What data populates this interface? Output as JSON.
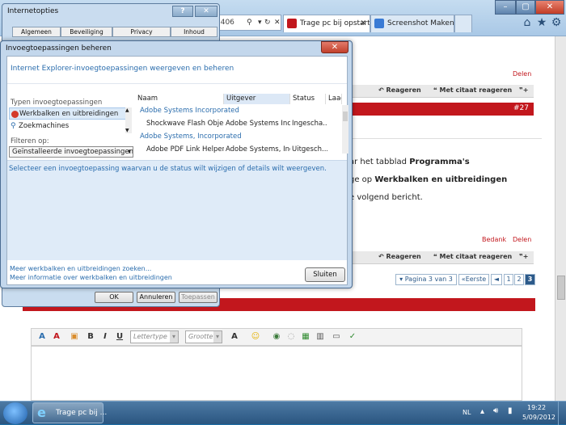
{
  "browser": {
    "address_fragment": "8406",
    "tabs": [
      {
        "label": "Trage pc bij opstart ...",
        "active": true
      },
      {
        "label": "Screenshot Maken - Byt...",
        "active": false
      }
    ],
    "window_controls": {
      "minimize": "–",
      "maximize": "▢",
      "close": "✕"
    }
  },
  "forum": {
    "delen_1": "Delen",
    "reageren": "Reageren",
    "met_citaat": "Met citaat reageren",
    "post_number": "#27",
    "text_line_1_prefix": "ar het tabblad ",
    "text_line_1_bold": "Programma's",
    "text_line_2_prefix": "ge op ",
    "text_line_2_bold": "Werkbalken en uitbreidingen",
    "text_line_3": "e volgend bericht.",
    "bedank": "Bedank",
    "delen_2": "Delen",
    "reageren_2": "Reageren",
    "met_citaat_2": "Met citaat reageren",
    "pager": {
      "label": "Pagina 3 van 3",
      "first": "«Eerste",
      "prev": "◄",
      "pages": [
        "1",
        "2",
        "3"
      ],
      "current": "3"
    },
    "editor": {
      "font_placeholder": "Lettertype",
      "size_placeholder": "Grootte",
      "bold": "B",
      "italic": "I",
      "underline": "U",
      "font_color": "A"
    }
  },
  "internet_options": {
    "title": "Internetopties",
    "tabs_row1": [
      "Algemeen",
      "Beveiliging",
      "Privacy",
      "Inhoud"
    ],
    "ok": "OK",
    "cancel": "Annuleren",
    "apply": "Toepassen",
    "help": "?",
    "close": "✕"
  },
  "addons": {
    "title": "Invoegtoepassingen beheren",
    "header": "Internet Explorer-invoegtoepassingen weergeven en beheren",
    "types_label": "Typen invoegtoepassingen",
    "types": [
      {
        "label": "Werkbalken en uitbreidingen",
        "selected": true
      },
      {
        "label": "Zoekmachines",
        "selected": false
      }
    ],
    "filter_label": "Filteren op:",
    "filter_value": "Geïnstalleerde invoegtoepassingen",
    "columns": [
      "Naam",
      "Uitgever",
      "Status",
      "Laad"
    ],
    "groups": [
      {
        "name": "Adobe Systems Incorporated",
        "rows": [
          {
            "name": "Shockwave Flash Object",
            "publisher": "Adobe Systems Inc...",
            "status": "Ingescha..."
          }
        ]
      },
      {
        "name": "Adobe Systems, Incorporated",
        "rows": [
          {
            "name": "Adobe PDF Link Helper",
            "publisher": "Adobe Systems, Inc...",
            "status": "Uitgesch..."
          }
        ]
      }
    ],
    "hint": "Selecteer een invoegtoepassing waarvan u de status wilt wijzigen of details wilt weergeven.",
    "link_find_more": "Meer werkbalken en uitbreidingen zoeken...",
    "link_more_info": "Meer informatie over werkbalken en uitbreidingen",
    "close_button": "Sluiten",
    "close_x": "✕"
  },
  "taskbar": {
    "ie_task": "Trage pc bij ...",
    "language": "NL",
    "time": "19:22",
    "date": "5/09/2012"
  },
  "colors": {
    "accent_red": "#c2171d",
    "link_blue": "#2b6dad"
  }
}
